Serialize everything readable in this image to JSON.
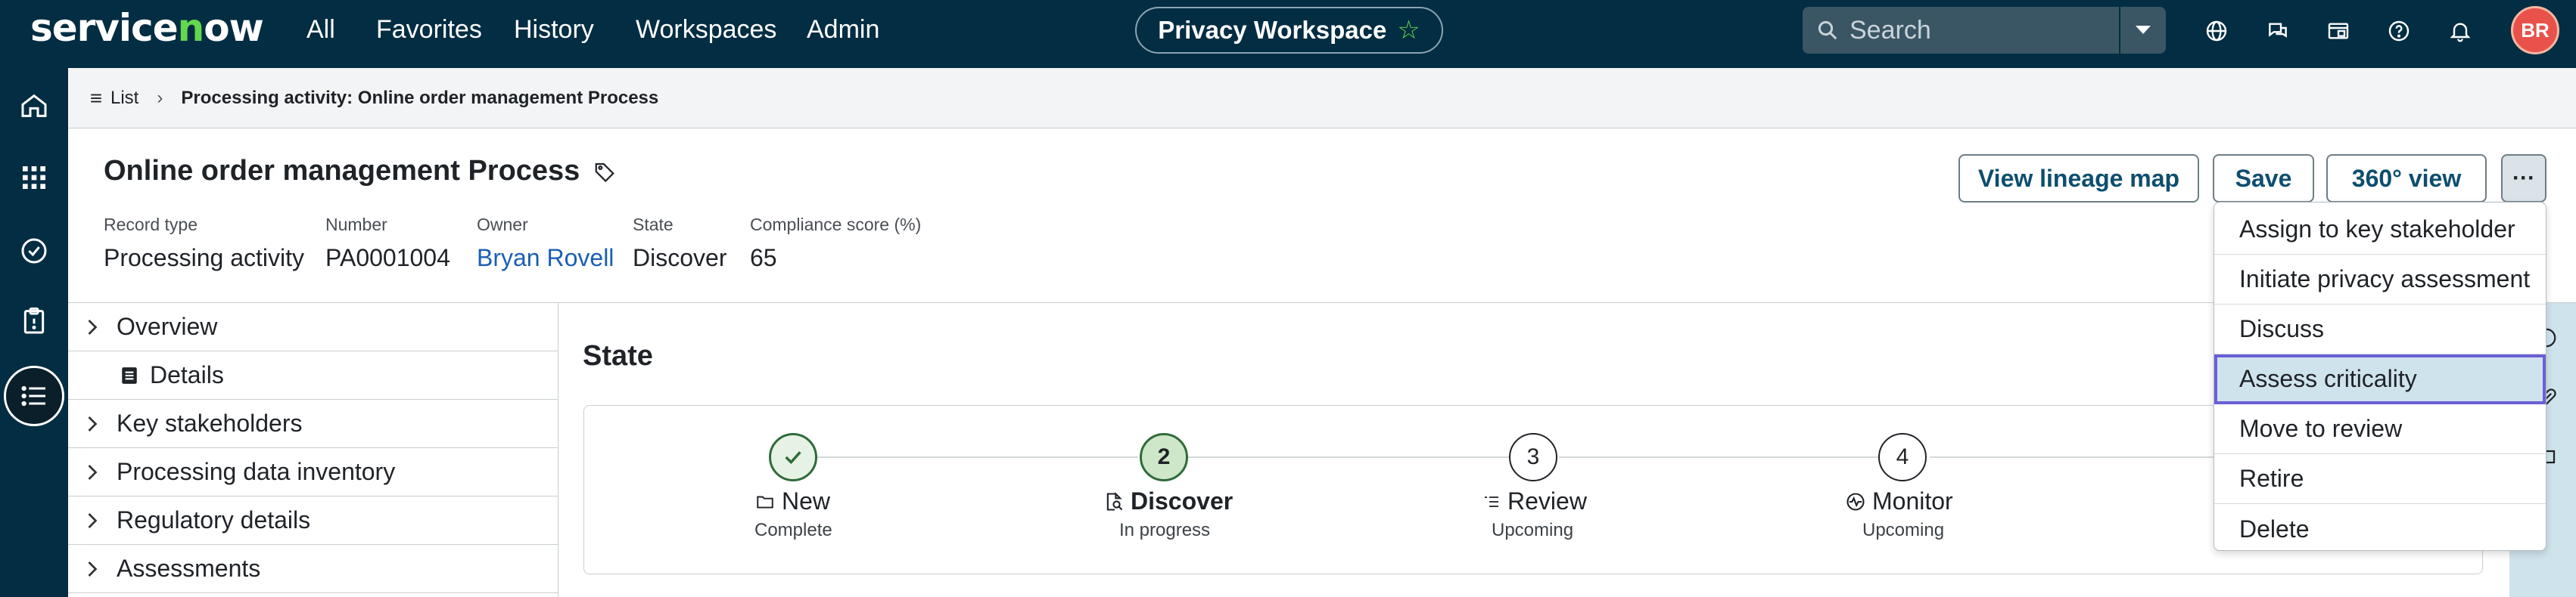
{
  "topbar": {
    "logo": "servicenow",
    "nav": [
      "All",
      "Favorites",
      "History",
      "Workspaces",
      "Admin"
    ],
    "workspace_pill": "Privacy Workspace",
    "search_placeholder": "Search",
    "user_initials": "BR"
  },
  "breadcrumb": {
    "list_label": "List",
    "current": "Processing activity: Online order management Process"
  },
  "record": {
    "title": "Online order management Process",
    "fields": [
      {
        "label": "Record type",
        "value": "Processing activity"
      },
      {
        "label": "Number",
        "value": "PA0001004"
      },
      {
        "label": "Owner",
        "value": "Bryan Rovell"
      },
      {
        "label": "State",
        "value": "Discover"
      },
      {
        "label": "Compliance score (%)",
        "value": "65"
      }
    ],
    "buttons": {
      "lineage": "View lineage map",
      "save": "Save",
      "view360": "360° view",
      "more": "···"
    }
  },
  "tree": {
    "items": [
      {
        "label": "Overview"
      },
      {
        "label": "Details"
      },
      {
        "label": "Key stakeholders"
      },
      {
        "label": "Processing data inventory"
      },
      {
        "label": "Regulatory details"
      },
      {
        "label": "Assessments"
      }
    ]
  },
  "state": {
    "title": "State",
    "steps": [
      {
        "number": "",
        "name": "New",
        "status": "Complete",
        "icon": "folder-icon"
      },
      {
        "number": "2",
        "name": "Discover",
        "status": "In progress",
        "icon": "search-doc-icon"
      },
      {
        "number": "3",
        "name": "Review",
        "status": "Upcoming",
        "icon": "list-icon"
      },
      {
        "number": "4",
        "name": "Monitor",
        "status": "Upcoming",
        "icon": "pulse-icon"
      }
    ]
  },
  "menu": {
    "items": [
      "Assign to key stakeholder",
      "Initiate privacy assessment",
      "Discuss",
      "Assess criticality",
      "Move to review",
      "Retire",
      "Delete"
    ],
    "highlighted_index": 3
  },
  "colors": {
    "topbar": "#032d42",
    "accent_green": "#62d84e",
    "link": "#1a5fb4",
    "highlight_outline": "#6b5fd6"
  }
}
